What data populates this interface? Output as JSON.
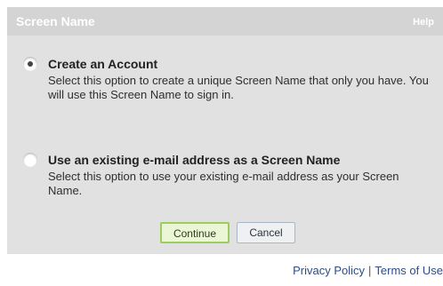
{
  "header": {
    "title": "Screen Name",
    "help_label": "Help"
  },
  "options": [
    {
      "label": "Create an Account",
      "description": "Select this option to create a unique Screen Name that only you have. You will use this Screen Name to sign in.",
      "selected": true
    },
    {
      "label": "Use an existing e-mail address as a Screen Name",
      "description": "Select this option to use your existing e-mail address as your Screen Name.",
      "selected": false
    }
  ],
  "buttons": {
    "continue_label": "Continue",
    "cancel_label": "Cancel"
  },
  "footer": {
    "privacy_label": "Privacy Policy",
    "separator": "|",
    "terms_label": "Terms of Use"
  },
  "colors": {
    "header_bg": "#d4d4d4",
    "panel_bg": "#e1e1e1",
    "continue_border": "#9ccd5e",
    "link": "#2e4d86"
  },
  "icons": {
    "radio_selected": "radio-selected-icon",
    "radio_unselected": "radio-unselected-icon"
  }
}
